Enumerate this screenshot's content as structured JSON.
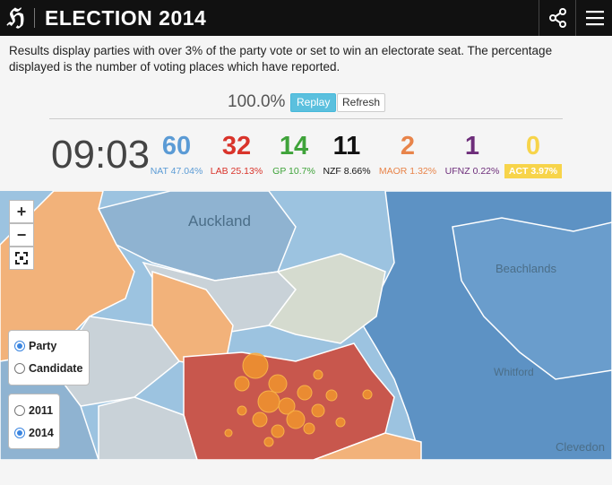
{
  "header": {
    "title": "ELECTION 2014",
    "logo_glyph": "ℌ",
    "share_icon": "share-icon",
    "menu_icon": "hamburger-menu-icon"
  },
  "intro": "Results display parties with over 3% of the party vote or set to win an electorate seat. The percentage displayed is the number of voting places which have reported.",
  "progress": {
    "value": "100.0%",
    "replay_label": "Replay",
    "refresh_label": "Refresh"
  },
  "clock": "09:03",
  "parties": [
    {
      "seats": "60",
      "label": "NAT 47.04%",
      "color": "#5b9bd5"
    },
    {
      "seats": "32",
      "label": "LAB 25.13%",
      "color": "#d9342b"
    },
    {
      "seats": "14",
      "label": "GP 10.7%",
      "color": "#3fa33a"
    },
    {
      "seats": "11",
      "label": "NZF 8.66%",
      "color": "#111111"
    },
    {
      "seats": "2",
      "label": "MAOR 1.32%",
      "color": "#e8844a"
    },
    {
      "seats": "1",
      "label": "UFNZ 0.22%",
      "color": "#6d2d7a"
    },
    {
      "seats": "0",
      "label": "ACT 3.97%",
      "color": "#f7d44a",
      "highlight": true
    }
  ],
  "map": {
    "places": [
      "Auckland",
      "Beachlands",
      "Whitford",
      "Clevedon"
    ],
    "zoom_in": "+",
    "zoom_out": "−",
    "fullscreen_icon": "fullscreen-icon",
    "view_options": [
      {
        "label": "Party",
        "selected": true
      },
      {
        "label": "Candidate",
        "selected": false
      }
    ],
    "year_options": [
      {
        "label": "2011",
        "selected": false
      },
      {
        "label": "2014",
        "selected": true
      }
    ],
    "colors": {
      "water": "#9cc3e0",
      "national": "#5d92c4",
      "labour": "#c8574d",
      "maori_orange": "#f2b27a",
      "grey_land": "#c9d2d8",
      "marker": "#f39a2a"
    }
  }
}
